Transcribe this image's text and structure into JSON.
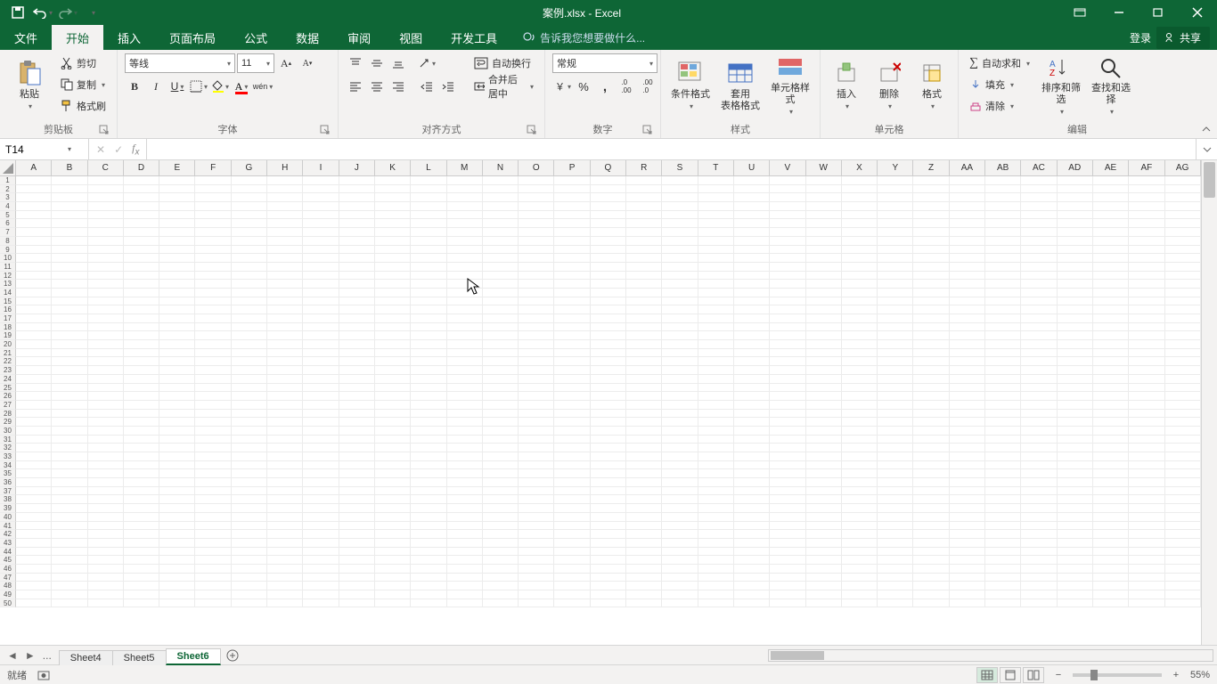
{
  "title": "案例.xlsx - Excel",
  "qat": {
    "save": "保存",
    "undo": "撤销",
    "redo": "恢复"
  },
  "tabs": [
    "文件",
    "开始",
    "插入",
    "页面布局",
    "公式",
    "数据",
    "审阅",
    "视图",
    "开发工具"
  ],
  "active_tab": "开始",
  "tell_me": "告诉我您想要做什么...",
  "login": "登录",
  "share": "共享",
  "ribbon": {
    "clipboard": {
      "paste": "粘贴",
      "cut": "剪切",
      "copy": "复制",
      "fmtpainter": "格式刷",
      "label": "剪贴板"
    },
    "font": {
      "name": "等线",
      "size": "11",
      "label": "字体",
      "bold": "B",
      "italic": "I",
      "underline": "U",
      "phonetic": "wén"
    },
    "align": {
      "wrap": "自动换行",
      "merge": "合并后居中",
      "label": "对齐方式"
    },
    "number": {
      "format": "常规",
      "label": "数字"
    },
    "styles": {
      "cond": "条件格式",
      "table": "套用\n表格格式",
      "cell": "单元格样式",
      "label": "样式"
    },
    "cells": {
      "insert": "插入",
      "delete": "删除",
      "format": "格式",
      "label": "单元格"
    },
    "editing": {
      "sum": "自动求和",
      "fill": "填充",
      "clear": "清除",
      "sort": "排序和筛选",
      "find": "查找和选择",
      "label": "编辑"
    }
  },
  "namebox": "T14",
  "columns": [
    "A",
    "B",
    "C",
    "D",
    "E",
    "F",
    "G",
    "H",
    "I",
    "J",
    "K",
    "L",
    "M",
    "N",
    "O",
    "P",
    "Q",
    "R",
    "S",
    "T",
    "U",
    "V",
    "W",
    "X",
    "Y",
    "Z",
    "AA",
    "AB",
    "AC",
    "AD",
    "AE",
    "AF",
    "AG"
  ],
  "row_count": 50,
  "sheets": {
    "prev": "Sheet4",
    "s5": "Sheet5",
    "active": "Sheet6",
    "ellipsis": "..."
  },
  "status": {
    "ready": "就绪",
    "zoom": "55%"
  }
}
